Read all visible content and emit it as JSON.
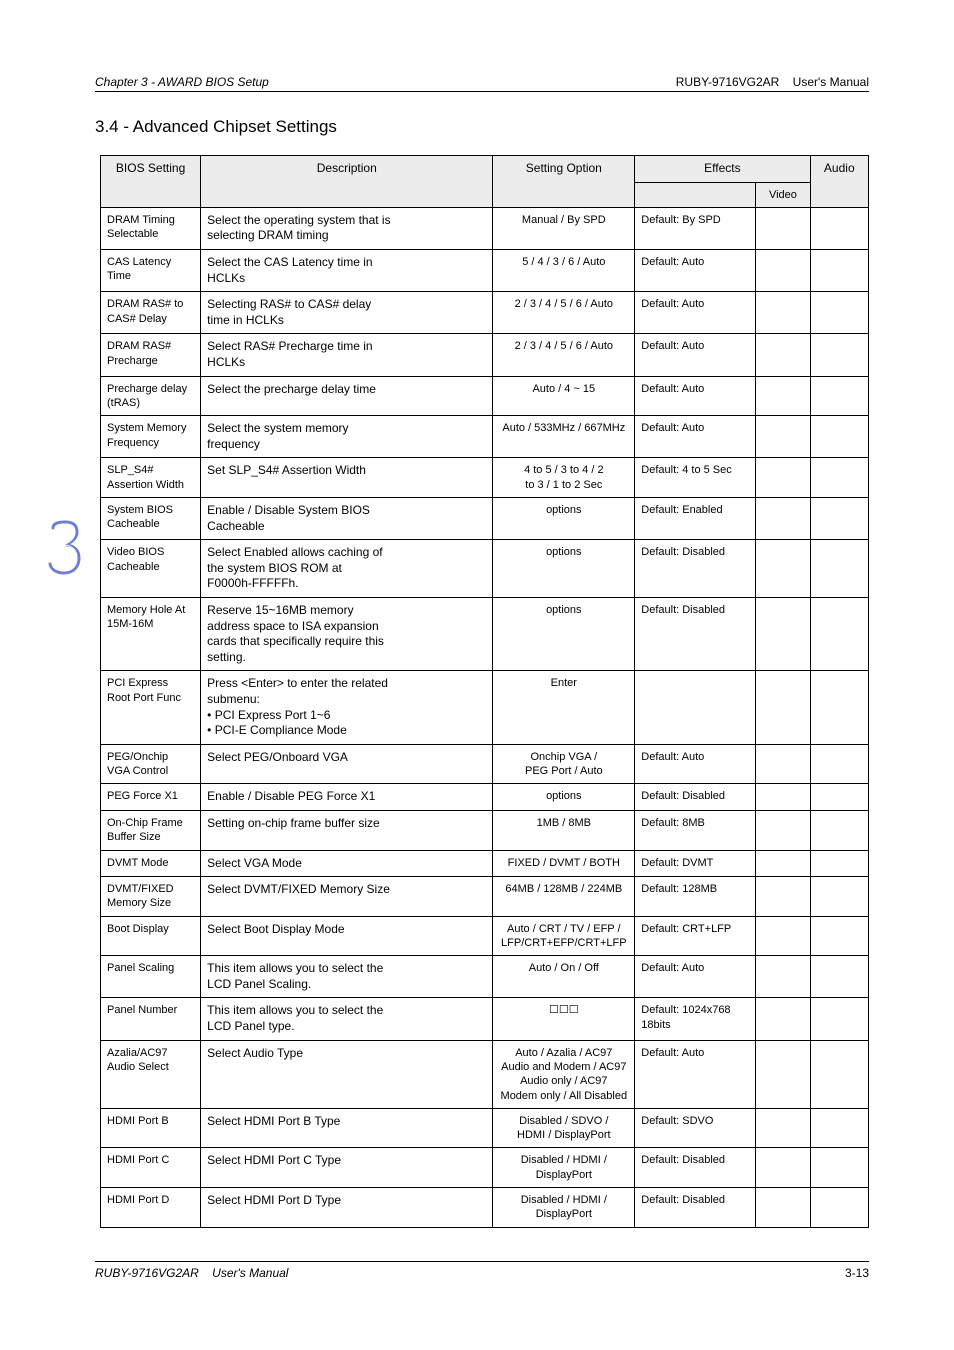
{
  "header": {
    "left_italic": "Chapter 3 - AWARD BIOS Setup",
    "right_text": "RUBY-9716VG2AR    User's Manual"
  },
  "section_title": "3.4 - Advanced Chipset Settings",
  "side_number": "3",
  "headers": {
    "bios_setting": "BIOS Setting",
    "description": "Description",
    "setting_option": "Setting Option",
    "effects": "Effects",
    "video": "Video",
    "audio": "Audio"
  },
  "footer": {
    "left_italic": "RUBY-9716VG2AR    User's Manual",
    "right_text": "3-13"
  },
  "rows": [
    {
      "setting": "DRAM Timing Selectable",
      "description": "Select the operating system that is\nselecting DRAM timing",
      "option": "Manual / By SPD",
      "effects_text": "Default: By SPD",
      "video": "",
      "audio": ""
    },
    {
      "setting": "CAS Latency Time",
      "description": "Select the CAS Latency time in\nHCLKs",
      "option": "5 / 4 / 3 / 6 / Auto",
      "effects_text": "Default: Auto",
      "video": "",
      "audio": ""
    },
    {
      "setting": "DRAM RAS# to CAS# Delay",
      "description": "Selecting RAS# to CAS# delay\ntime in HCLKs",
      "option": "2 / 3 / 4 / 5 / 6 / Auto",
      "effects_text": "Default: Auto",
      "video": "",
      "audio": ""
    },
    {
      "setting": "DRAM RAS# Precharge",
      "description": "Select RAS# Precharge time in\nHCLKs",
      "option": "2 / 3 / 4 / 5 / 6 / Auto",
      "effects_text": "Default: Auto",
      "video": "",
      "audio": ""
    },
    {
      "setting": "Precharge delay (tRAS)",
      "description": "Select the precharge delay time",
      "option": "Auto / 4 ~ 15",
      "effects_text": "Default: Auto",
      "video": "",
      "audio": ""
    },
    {
      "setting": "System Memory Frequency",
      "description": "Select the system memory\nfrequency",
      "option": "Auto / 533MHz / 667MHz",
      "effects_text": "Default: Auto",
      "video": "",
      "audio": ""
    },
    {
      "setting": "SLP_S4# Assertion Width",
      "description": "Set SLP_S4# Assertion Width",
      "option": "4 to 5 / 3 to 4 / 2\nto 3 / 1 to 2 Sec",
      "effects_text": "Default: 4 to 5 Sec",
      "video": "",
      "audio": ""
    },
    {
      "setting": "System BIOS Cacheable",
      "description": "Enable / Disable System BIOS\nCacheable",
      "option": "options",
      "effects_text": "Default: Enabled",
      "video": "",
      "audio": ""
    },
    {
      "setting": "Video BIOS Cacheable",
      "description": "Select Enabled allows caching of\nthe system BIOS ROM at\nF0000h-FFFFFh.",
      "option": "options",
      "effects_text": "Default: Disabled",
      "video": "",
      "audio": ""
    },
    {
      "setting": "Memory Hole At 15M-16M",
      "description": "Reserve 15~16MB memory\naddress space to ISA expansion\ncards that specifically require this\nsetting.",
      "option": "options",
      "effects_text": "Default: Disabled",
      "video": "",
      "audio": ""
    },
    {
      "setting": "PCI Express Root Port Func",
      "description": "Press <Enter> to enter the related\nsubmenu:\n• PCI Express Port 1~6\n• PCI-E Compliance Mode",
      "option": "Enter",
      "effects_text": "",
      "video": "",
      "audio": ""
    },
    {
      "setting": "PEG/Onchip VGA Control",
      "description": "Select PEG/Onboard VGA",
      "option": "Onchip VGA /\nPEG Port / Auto",
      "effects_text": "Default: Auto",
      "video": "",
      "audio": ""
    },
    {
      "setting": "PEG Force X1",
      "description": "Enable / Disable PEG Force X1",
      "option": "options",
      "effects_text": "Default: Disabled",
      "video": "",
      "audio": ""
    },
    {
      "setting": "On-Chip Frame Buffer Size",
      "description": "Setting on-chip frame buffer size",
      "option": "1MB / 8MB",
      "effects_text": "Default: 8MB",
      "video": "",
      "audio": ""
    },
    {
      "setting": "DVMT Mode",
      "description": "Select VGA Mode",
      "option": "FIXED / DVMT / BOTH",
      "effects_text": "Default: DVMT",
      "video": "",
      "audio": ""
    },
    {
      "setting": "DVMT/FIXED Memory Size",
      "description": "Select DVMT/FIXED Memory Size",
      "option": "64MB / 128MB / 224MB",
      "effects_text": "Default: 128MB",
      "video": "",
      "audio": ""
    },
    {
      "setting": "Boot Display",
      "description": "Select Boot Display Mode",
      "option": "Auto / CRT / TV / EFP /\nLFP/CRT+EFP/CRT+LFP",
      "effects_text": "Default: CRT+LFP",
      "video": "",
      "audio": ""
    },
    {
      "setting": "Panel Scaling",
      "description": "This item allows you to select the\nLCD Panel Scaling.",
      "option": "Auto / On / Off",
      "effects_text": "Default: Auto",
      "video": "",
      "audio": ""
    },
    {
      "setting": "Panel Number",
      "description": "This item allows you to select the\nLCD Panel type.",
      "option": "☐☐☐",
      "effects_text": "Default: 1024x768  18bits",
      "video": "",
      "audio": ""
    },
    {
      "setting": "Azalia/AC97 Audio Select",
      "description": "Select Audio Type",
      "option": "Auto / Azalia / AC97\nAudio and Modem / AC97\nAudio only / AC97\nModem only / All Disabled",
      "effects_text": "Default: Auto",
      "video": "",
      "audio": ""
    },
    {
      "setting": "HDMI Port B",
      "description": "Select HDMI Port B Type",
      "option": "Disabled / SDVO /\nHDMI / DisplayPort",
      "effects_text": "Default: SDVO",
      "video": "",
      "audio": ""
    },
    {
      "setting": "HDMI Port C",
      "description": "Select HDMI Port C Type",
      "option": "Disabled / HDMI /\nDisplayPort",
      "effects_text": "Default: Disabled",
      "video": "",
      "audio": ""
    },
    {
      "setting": "HDMI Port D",
      "description": "Select HDMI Port D Type",
      "option": "Disabled / HDMI /\nDisplayPort",
      "effects_text": "Default: Disabled",
      "video": "",
      "audio": ""
    }
  ]
}
